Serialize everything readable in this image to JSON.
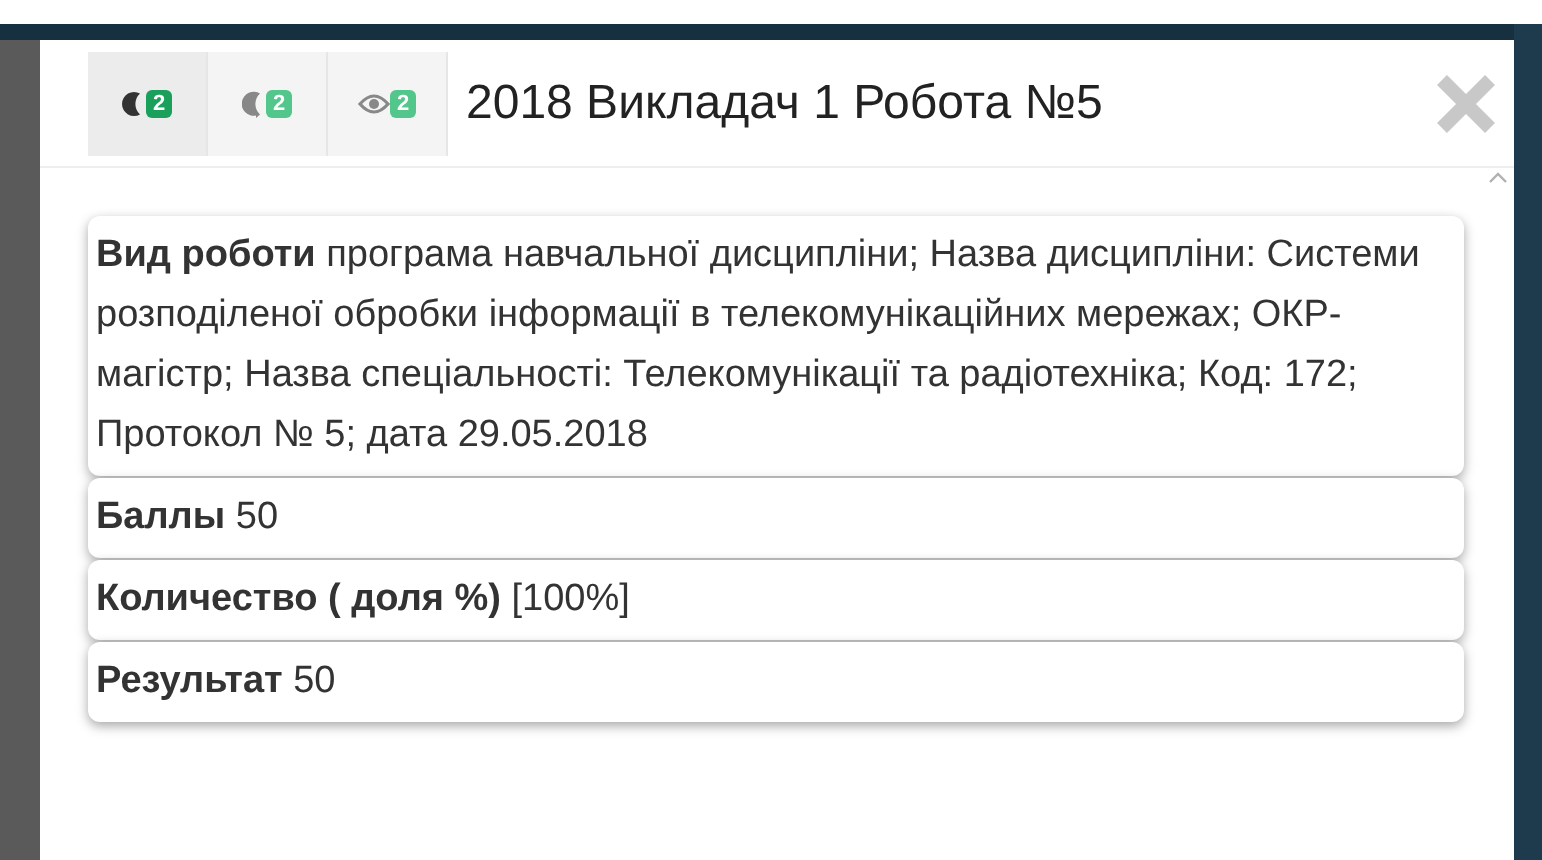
{
  "toolbar": [
    {
      "kind": "moon",
      "badge": "2",
      "selected": true
    },
    {
      "kind": "comment",
      "badge": "2",
      "selected": false
    },
    {
      "kind": "eye",
      "badge": "2",
      "selected": false
    }
  ],
  "title": "2018 Викладач 1 Робота №5",
  "fields": [
    {
      "label": "Вид роботи",
      "value": "програма навчальної дисципліни; Назва дисципліни: Системи розподіленої обробки інформації в телекомунікаційних мережах; ОКР-магістр; Назва спеціальності: Телекомунікації та радіотехніка; Код: 172; Протокол № 5; дата 29.05.2018"
    },
    {
      "label": "Баллы",
      "value": "50"
    },
    {
      "label": "Количество ( доля %)",
      "value": "[100%]"
    },
    {
      "label": "Результат",
      "value": "50"
    }
  ]
}
